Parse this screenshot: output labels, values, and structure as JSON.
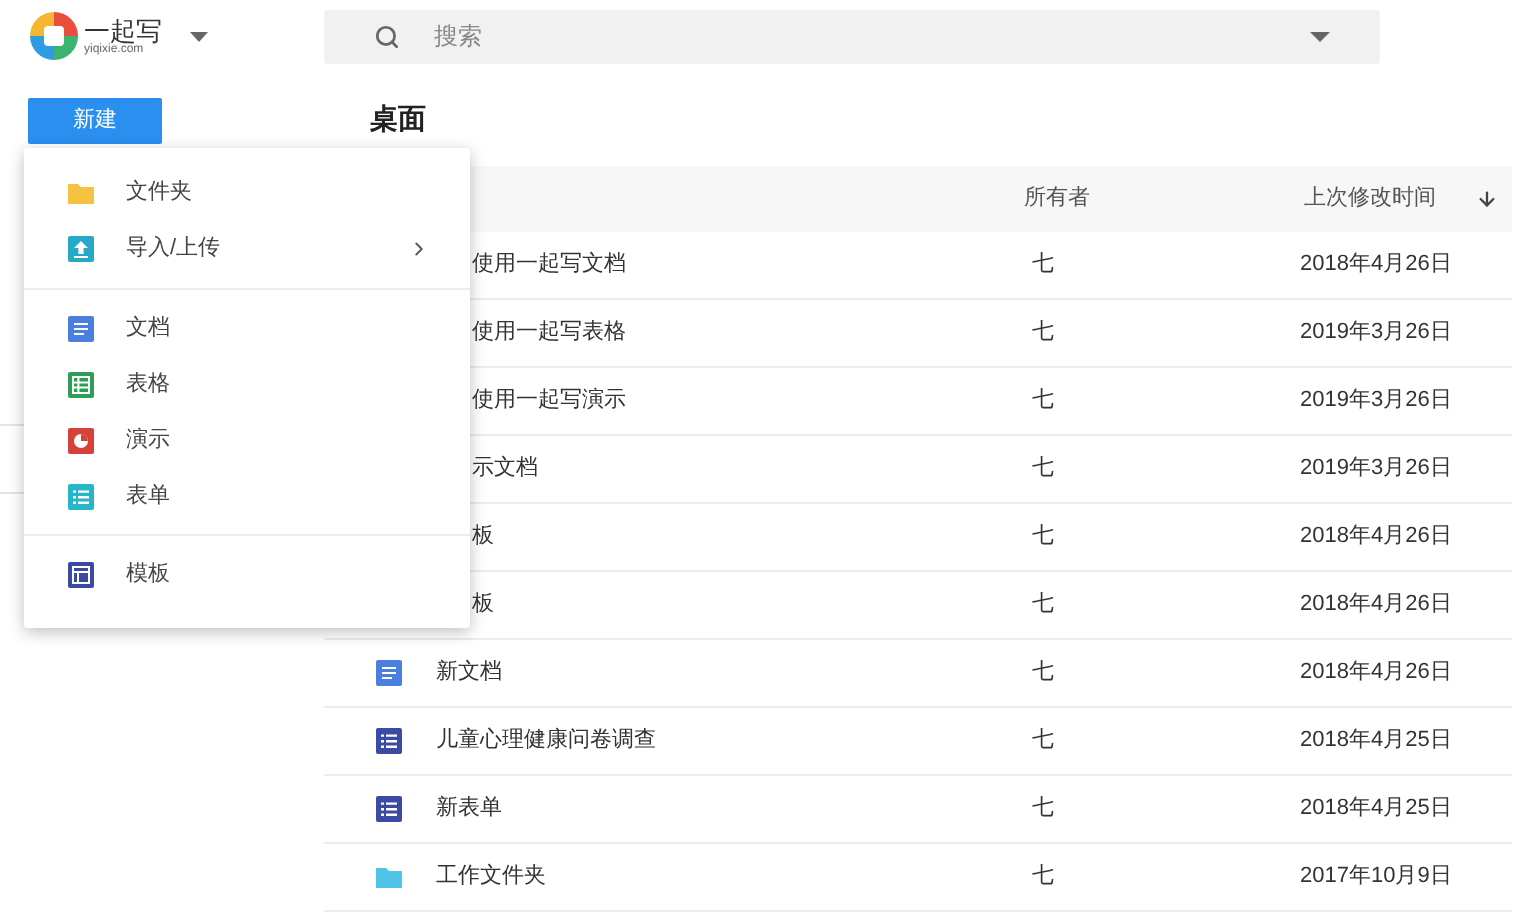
{
  "header": {
    "logo_title": "一起写",
    "logo_subtitle": "yiqixie.com",
    "search": {
      "placeholder": "搜索"
    }
  },
  "sidebar": {
    "new_button": "新建"
  },
  "main": {
    "title": "桌面"
  },
  "table": {
    "columns": [
      {
        "label": "所有者"
      },
      {
        "label": "上次修改时间",
        "sorted": true
      }
    ],
    "rows": [
      {
        "kind": "covered",
        "name": "使用一起写文档",
        "owner": "七",
        "modified": "2018年4月26日"
      },
      {
        "kind": "covered",
        "name": "使用一起写表格",
        "owner": "七",
        "modified": "2019年3月26日"
      },
      {
        "kind": "covered",
        "name": "使用一起写演示",
        "owner": "七",
        "modified": "2019年3月26日"
      },
      {
        "kind": "covered",
        "name": "示文档",
        "owner": "七",
        "modified": "2019年3月26日"
      },
      {
        "kind": "covered",
        "name": "板",
        "owner": "七",
        "modified": "2018年4月26日"
      },
      {
        "kind": "covered",
        "name": "板",
        "owner": "七",
        "modified": "2018年4月26日"
      },
      {
        "kind": "doc",
        "name": "新文档",
        "owner": "七",
        "modified": "2018年4月26日"
      },
      {
        "kind": "form",
        "name": "儿童心理健康问卷调查",
        "owner": "七",
        "modified": "2018年4月25日"
      },
      {
        "kind": "form",
        "name": "新表单",
        "owner": "七",
        "modified": "2018年4月25日"
      },
      {
        "kind": "folder",
        "name": "工作文件夹",
        "owner": "七",
        "modified": "2017年10月9日"
      }
    ]
  },
  "new_menu": {
    "groups": [
      [
        {
          "kind": "folder",
          "label": "文件夹",
          "submenu": false
        },
        {
          "kind": "upload",
          "label": "导入/上传",
          "submenu": true
        }
      ],
      [
        {
          "kind": "doc",
          "label": "文档",
          "submenu": false
        },
        {
          "kind": "sheet",
          "label": "表格",
          "submenu": false
        },
        {
          "kind": "slides",
          "label": "演示",
          "submenu": false
        },
        {
          "kind": "form",
          "label": "表单",
          "submenu": false
        }
      ],
      [
        {
          "kind": "template",
          "label": "模板",
          "submenu": false
        }
      ]
    ]
  }
}
